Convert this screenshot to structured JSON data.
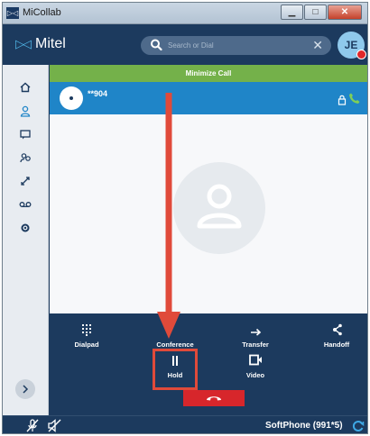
{
  "window": {
    "title": "MiCollab",
    "app_icon": "micollab-app-icon",
    "controls": [
      "minimize-icon",
      "maximize-icon",
      "close-icon"
    ]
  },
  "header": {
    "logo_text": "Mitel",
    "search": {
      "placeholder": "Search or Dial"
    },
    "avatar_initials": "JE",
    "presence_color": "#e0272a"
  },
  "sidebar": {
    "items": [
      "home-icon",
      "contacts-icon",
      "chat-icon",
      "people-icon",
      "transfer-icon",
      "voicemail-icon",
      "settings-icon"
    ],
    "expand_icon": "chevron-right-icon"
  },
  "call": {
    "minimize_label": "Minimize Call",
    "number": "**904",
    "icons": [
      "lock-icon",
      "phone-icon"
    ]
  },
  "controls": {
    "dialpad": "Dialpad",
    "conference": "Conference",
    "transfer": "Transfer",
    "handoff": "Handoff",
    "hold": "Hold",
    "video": "Video",
    "end_call_icon": "hang-up-icon"
  },
  "status": {
    "softphone": "SoftPhone (991*5)",
    "icons": [
      "mic-muted-icon",
      "speaker-muted-icon",
      "sync-icon"
    ]
  },
  "colors": {
    "brand_navy": "#1c3a5e",
    "call_blue": "#1f85c8",
    "minimize_green": "#74b14a",
    "end_call_red": "#d7262b",
    "annotation_red": "#e04a3a"
  }
}
